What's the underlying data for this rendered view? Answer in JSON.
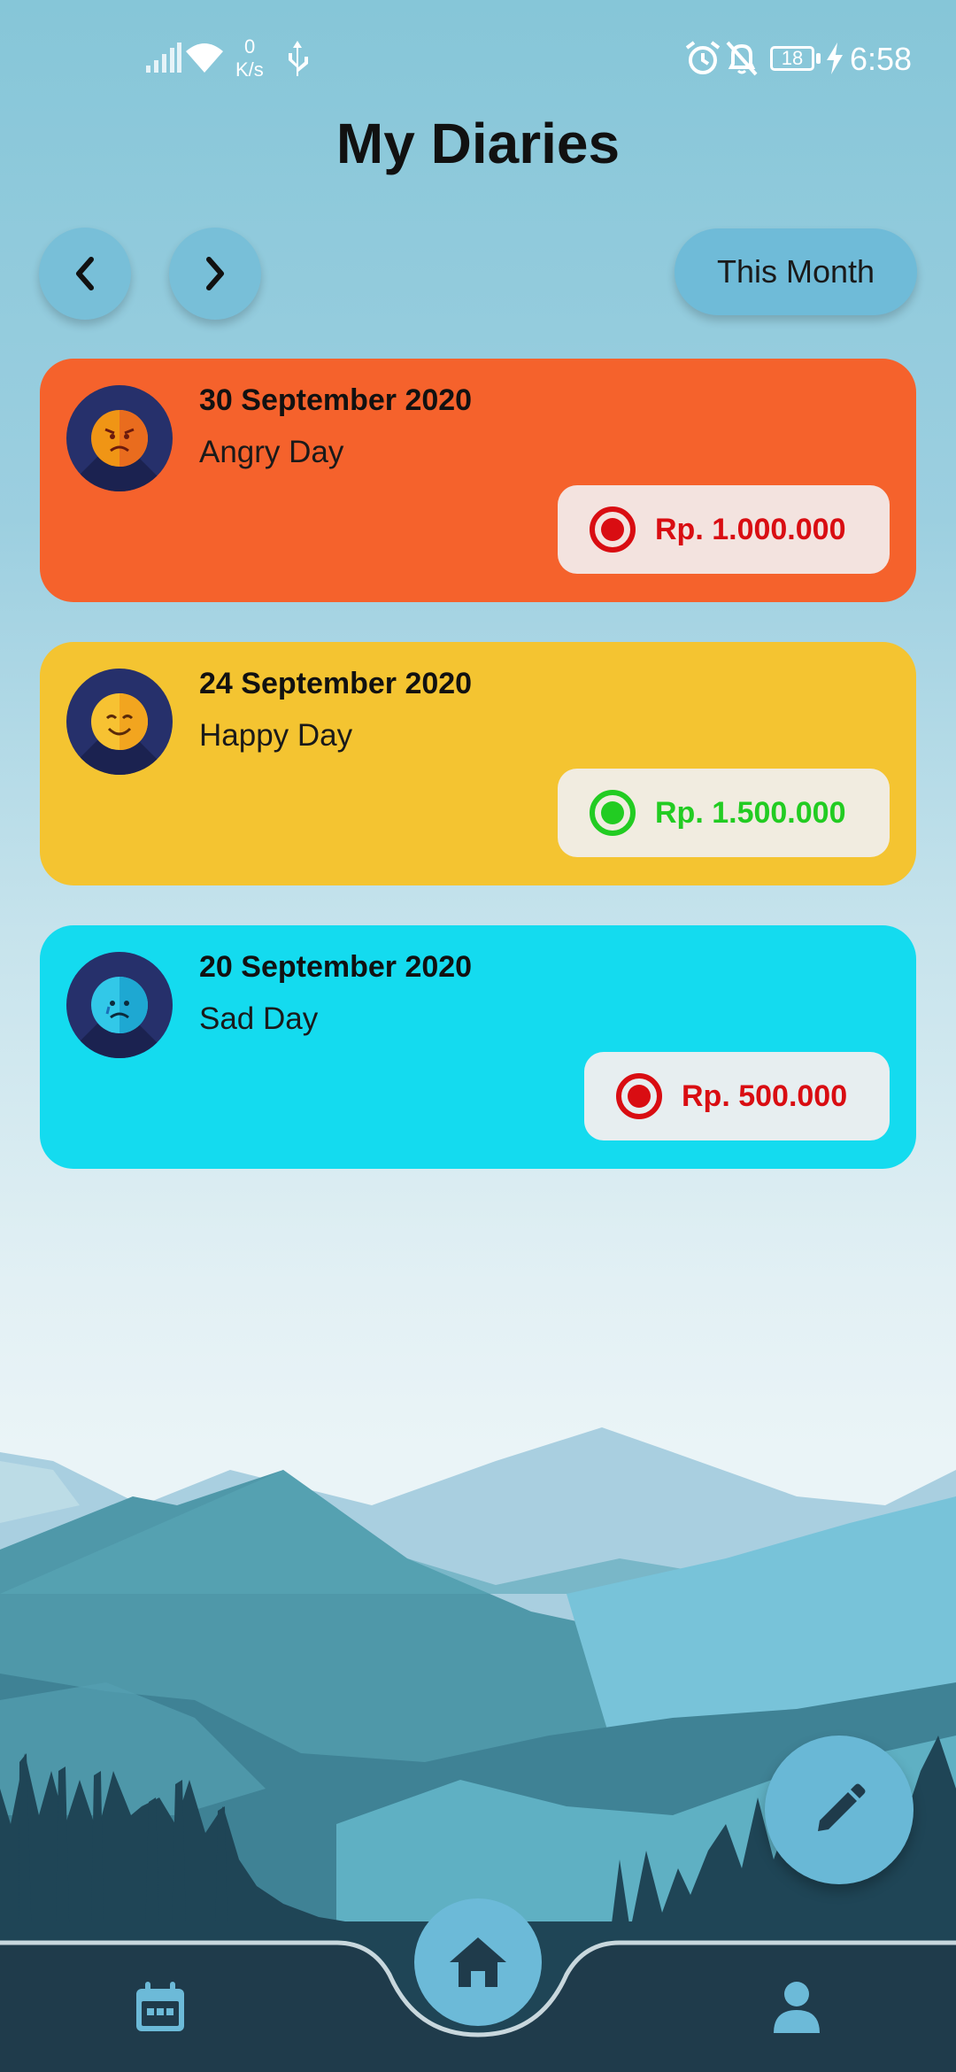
{
  "status_bar": {
    "network_speed_value": "0",
    "network_speed_unit": "K/s",
    "battery_level": "18",
    "time": "6:58"
  },
  "header": {
    "title": "My Diaries",
    "filter_label": "This Month"
  },
  "entries": [
    {
      "date": "30 September 2020",
      "mood": "Angry Day",
      "amount": "Rp. 1.000.000",
      "card_color": "#f5622c",
      "amount_color": "#d90d12",
      "amount_bg": "#f3e3df",
      "face_color": "#f09515",
      "icon": "angry-face-icon"
    },
    {
      "date": "24 September 2020",
      "mood": "Happy Day",
      "amount": "Rp. 1.500.000",
      "card_color": "#f4c431",
      "amount_color": "#22cc22",
      "amount_bg": "#f1ece0",
      "face_color": "#f7c232",
      "icon": "happy-face-icon"
    },
    {
      "date": "20 September 2020",
      "mood": "Sad Day",
      "amount": "Rp. 500.000",
      "card_color": "#14dbef",
      "amount_color": "#d90d12",
      "amount_bg": "#e7eef0",
      "face_color": "#32c8e8",
      "icon": "sad-face-icon"
    }
  ],
  "bottom_nav": {
    "items": [
      "calendar-icon",
      "home-icon",
      "profile-icon"
    ]
  },
  "colors": {
    "nav_bar": "#1f3b4b",
    "accent": "#6cbad8"
  }
}
